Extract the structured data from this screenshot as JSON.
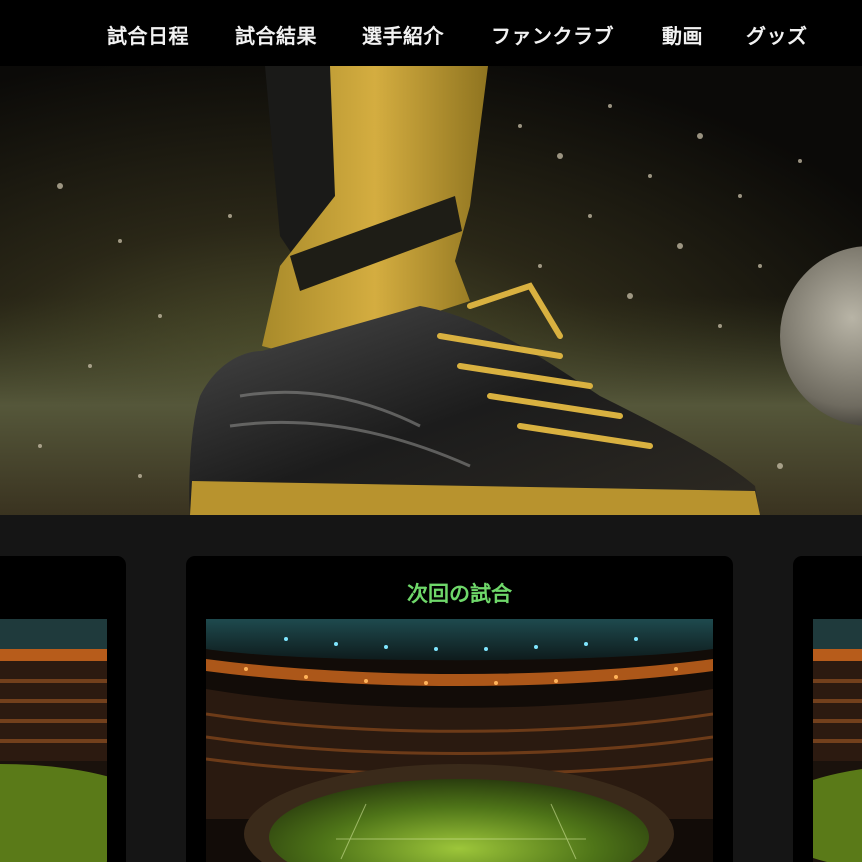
{
  "nav": {
    "items": [
      {
        "label": "試合日程"
      },
      {
        "label": "試合結果"
      },
      {
        "label": "選手紹介"
      },
      {
        "label": "ファンクラブ"
      },
      {
        "label": "動画"
      },
      {
        "label": "グッズ"
      }
    ]
  },
  "hero": {
    "image": "soccer-cleat-kicking-ball"
  },
  "cards": {
    "center": {
      "title": "次回の試合",
      "image": "stadium-night"
    },
    "left": {
      "image": "stadium-night"
    },
    "right": {
      "image": "stadium-night"
    }
  },
  "colors": {
    "nav_bg": "#000000",
    "page_bg": "#151515",
    "card_bg": "#000000",
    "accent": "#6fd86a"
  }
}
